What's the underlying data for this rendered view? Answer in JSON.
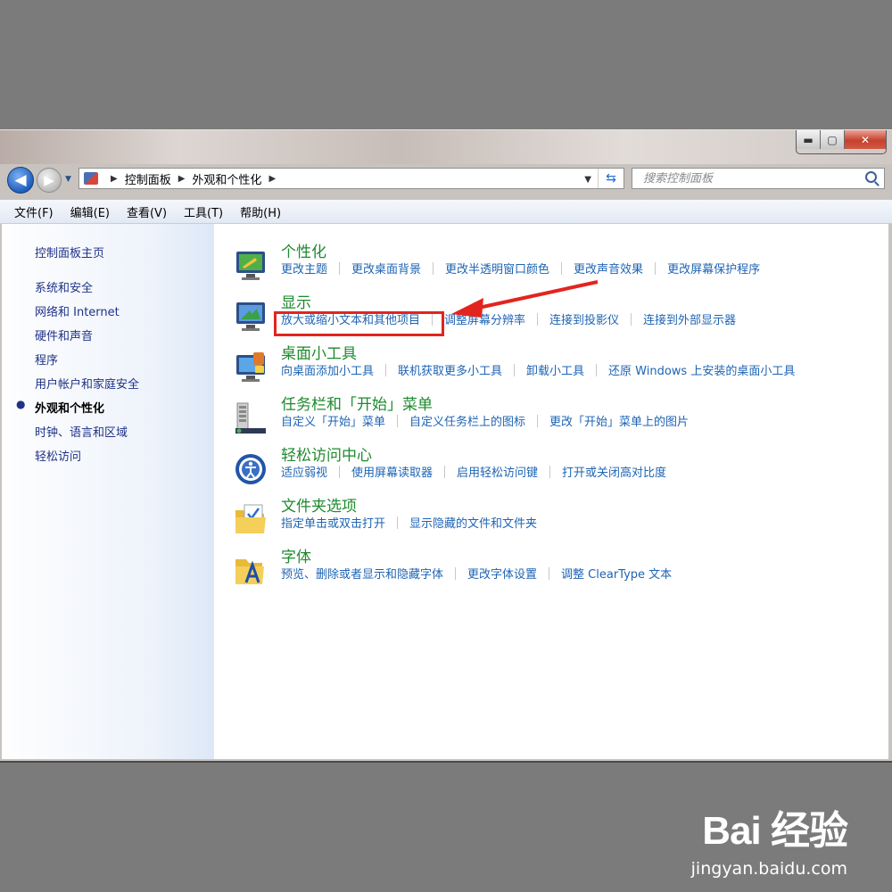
{
  "window": {
    "buttons": {
      "minimize": "▬",
      "maximize": "▢",
      "close": "✕"
    }
  },
  "nav": {
    "back_glyph": "◀",
    "forward_glyph": "▶",
    "breadcrumb": [
      "控制面板",
      "外观和个性化"
    ],
    "search_placeholder": "搜索控制面板"
  },
  "menu": [
    "文件(F)",
    "编辑(E)",
    "查看(V)",
    "工具(T)",
    "帮助(H)"
  ],
  "sidebar": {
    "home": "控制面板主页",
    "items": [
      "系统和安全",
      "网络和 Internet",
      "硬件和声音",
      "程序",
      "用户帐户和家庭安全",
      "外观和个性化",
      "时钟、语言和区域",
      "轻松访问"
    ],
    "current_index": 5
  },
  "categories": [
    {
      "title": "个性化",
      "icon": "personalization-icon",
      "links": [
        "更改主题",
        "更改桌面背景",
        "更改半透明窗口颜色",
        "更改声音效果",
        "更改屏幕保护程序"
      ]
    },
    {
      "title": "显示",
      "icon": "display-icon",
      "links": [
        "放大或缩小文本和其他项目",
        "调整屏幕分辨率",
        "连接到投影仪",
        "连接到外部显示器"
      ]
    },
    {
      "title": "桌面小工具",
      "icon": "gadgets-icon",
      "links": [
        "向桌面添加小工具",
        "联机获取更多小工具",
        "卸载小工具",
        "还原 Windows 上安装的桌面小工具"
      ]
    },
    {
      "title": "任务栏和「开始」菜单",
      "icon": "taskbar-icon",
      "links": [
        "自定义「开始」菜单",
        "自定义任务栏上的图标",
        "更改「开始」菜单上的图片"
      ]
    },
    {
      "title": "轻松访问中心",
      "icon": "ease-of-access-icon",
      "links": [
        "适应弱视",
        "使用屏幕读取器",
        "启用轻松访问键",
        "打开或关闭高对比度"
      ]
    },
    {
      "title": "文件夹选项",
      "icon": "folder-options-icon",
      "links": [
        "指定单击或双击打开",
        "显示隐藏的文件和文件夹"
      ]
    },
    {
      "title": "字体",
      "icon": "fonts-icon",
      "links": [
        "预览、删除或者显示和隐藏字体",
        "更改字体设置",
        "调整 ClearType 文本"
      ]
    }
  ],
  "annotation": {
    "color": "#e3241e",
    "target": "放大或缩小文本和其他项目"
  },
  "watermark": {
    "logo": "Bai 经验",
    "url": "jingyan.baidu.com"
  },
  "colors": {
    "link": "#1e64b4",
    "category_title": "#1e8a2e",
    "sidebar_link": "#1e3287"
  }
}
